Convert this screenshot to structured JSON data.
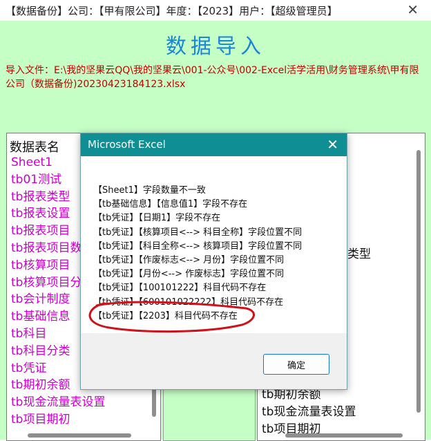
{
  "window": {
    "title": "【数据备份】公司：【甲有限公司】年度：【2023】用户：【超级管理员】",
    "close_glyph": "✕"
  },
  "form": {
    "heading": "数据导入",
    "import_path": "导入文件：E:\\我的坚果云QQ\\我的坚果云\\001-公众号\\002-Excel活学活用\\财务管理系统\\甲有限公司（数据备份)20230423184123.xlsx"
  },
  "left_panel": {
    "header": "数据表名",
    "items": [
      "Sheet1",
      "tb01测试",
      "tb报表类型",
      "tb报表设置",
      "tb报表项目",
      "tb报表项目数",
      "tb核算项目",
      "tb核算项目分",
      "tb会计制度",
      "tb基础信息",
      "tb科目",
      "tb科目分类",
      "tb凭证",
      "tb期初余额",
      "tb现金流量表设置",
      "tb项目期初"
    ]
  },
  "right_panel": {
    "visible_fragment": "类型",
    "items": [
      "tb期初余额",
      "tb现金流量表设置",
      "tb项目期初"
    ]
  },
  "dialog": {
    "title": "Microsoft Excel",
    "close_glyph": "✕",
    "messages": [
      "【Sheet1】字段数量不一致",
      "【tb基础信息】【信息值1】字段不存在",
      "【tb凭证】【日期1】字段不存在",
      "【tb凭证】【核算项目<--> 科目全称】字段位置不同",
      "【tb凭证】【科目全称<--> 核算项目】字段位置不同",
      "【tb凭证】【作废标志<--> 月份】字段位置不同",
      "【tb凭证】【月份<--> 作废标志】字段位置不同",
      "【tb凭证】【100101222】科目代码不存在",
      "【tb凭证】【600101022222】科目代码不存在",
      "【tb凭证】【2203】科目代码不存在"
    ],
    "ok_label": "确定"
  },
  "colors": {
    "form_bg": "#c6ffc6",
    "heading": "#1a86d8",
    "path_text": "#c00000",
    "list_text": "#cc00cc",
    "dialog_title_bg": "#0f8f93",
    "annotation": "#d0101a"
  }
}
